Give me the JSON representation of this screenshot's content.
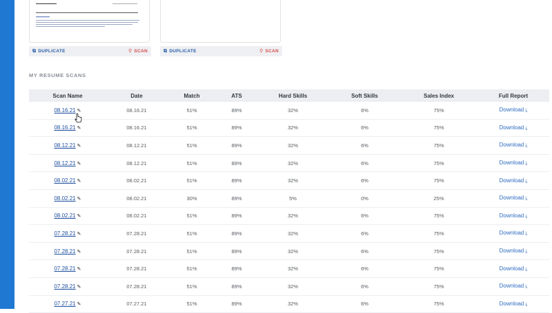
{
  "templates": [
    {
      "duplicate_label": "DUPLICATE",
      "scan_label": "SCAN"
    },
    {
      "duplicate_label": "DUPLICATE",
      "scan_label": "SCAN"
    }
  ],
  "section_title": "MY RESUME SCANS",
  "table": {
    "headers": [
      "Scan Name",
      "Date",
      "Match",
      "ATS",
      "Hard Skills",
      "Soft Skills",
      "Sales Index",
      "Full Report"
    ],
    "rows": [
      {
        "name": "08.16.21",
        "date": "08.16.21",
        "match": "51%",
        "ats": "89%",
        "hard": "32%",
        "soft": "6%",
        "sales": "75%",
        "report": "Download"
      },
      {
        "name": "08.16.21",
        "date": "08.16.21",
        "match": "51%",
        "ats": "89%",
        "hard": "32%",
        "soft": "6%",
        "sales": "75%",
        "report": "Download"
      },
      {
        "name": "08.12.21",
        "date": "08.12.21",
        "match": "51%",
        "ats": "89%",
        "hard": "32%",
        "soft": "6%",
        "sales": "75%",
        "report": "Download"
      },
      {
        "name": "08.12.21",
        "date": "08.12.21",
        "match": "51%",
        "ats": "89%",
        "hard": "32%",
        "soft": "6%",
        "sales": "75%",
        "report": "Download"
      },
      {
        "name": "08.02.21",
        "date": "08.02.21",
        "match": "51%",
        "ats": "89%",
        "hard": "32%",
        "soft": "6%",
        "sales": "75%",
        "report": "Download"
      },
      {
        "name": "08.02.21",
        "date": "08.02.21",
        "match": "30%",
        "ats": "89%",
        "hard": "5%",
        "soft": "0%",
        "sales": "25%",
        "report": "Download"
      },
      {
        "name": "08.02.21",
        "date": "08.02.21",
        "match": "51%",
        "ats": "89%",
        "hard": "32%",
        "soft": "6%",
        "sales": "75%",
        "report": "Download"
      },
      {
        "name": "07.28.21",
        "date": "07.28.21",
        "match": "51%",
        "ats": "89%",
        "hard": "32%",
        "soft": "6%",
        "sales": "75%",
        "report": "Download"
      },
      {
        "name": "07.28.21",
        "date": "07.28.21",
        "match": "51%",
        "ats": "89%",
        "hard": "32%",
        "soft": "6%",
        "sales": "75%",
        "report": "Download"
      },
      {
        "name": "07.28.21",
        "date": "07.28.21",
        "match": "51%",
        "ats": "89%",
        "hard": "32%",
        "soft": "6%",
        "sales": "75%",
        "report": "Download"
      },
      {
        "name": "07.28.21",
        "date": "07.28.21",
        "match": "51%",
        "ats": "89%",
        "hard": "32%",
        "soft": "6%",
        "sales": "75%",
        "report": "Download"
      },
      {
        "name": "07.27.21",
        "date": "07.27.21",
        "match": "51%",
        "ats": "89%",
        "hard": "32%",
        "soft": "6%",
        "sales": "75%",
        "report": "Download"
      }
    ]
  },
  "icons": {
    "duplicate": "copy-icon",
    "scan": "search-icon",
    "edit": "pencil-icon",
    "download": "download-icon"
  },
  "colors": {
    "sidebar": "#1f78d1",
    "link": "#1d4f9e",
    "scan_action": "#d94b4b",
    "header_bg": "#eceef1"
  }
}
